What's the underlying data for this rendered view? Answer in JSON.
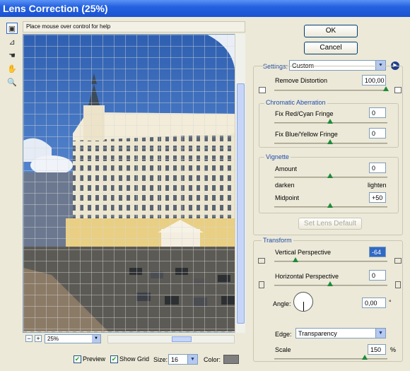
{
  "window": {
    "title": "Lens Correction (25%)"
  },
  "hint": "Place mouse over control for help",
  "buttons": {
    "ok": "OK",
    "cancel": "Cancel",
    "set_lens_default": "Set Lens Default"
  },
  "settings": {
    "label": "Settings:",
    "value": "Custom"
  },
  "remove_distortion": {
    "label": "Remove Distortion",
    "value": "100,00"
  },
  "chromatic": {
    "title": "Chromatic Aberration",
    "red_cyan": {
      "label": "Fix Red/Cyan Fringe",
      "value": "0"
    },
    "blue_yellow": {
      "label": "Fix Blue/Yellow Fringe",
      "value": "0"
    }
  },
  "vignette": {
    "title": "Vignette",
    "amount": {
      "label": "Amount",
      "value": "0"
    },
    "darken": "darken",
    "lighten": "lighten",
    "midpoint": {
      "label": "Midpoint",
      "value": "+50"
    }
  },
  "transform": {
    "title": "Transform",
    "vertical": {
      "label": "Vertical Perspective",
      "value": "-64"
    },
    "horizontal": {
      "label": "Horizontal Perspective",
      "value": "0"
    },
    "angle": {
      "label": "Angle:",
      "value": "0,00",
      "unit": "°"
    },
    "edge": {
      "label": "Edge:",
      "value": "Transparency"
    },
    "scale": {
      "label": "Scale",
      "value": "150",
      "unit": "%"
    }
  },
  "zoom": {
    "value": "25%",
    "minus": "−",
    "plus": "+"
  },
  "options": {
    "preview": "Preview",
    "show_grid": "Show Grid",
    "size_label": "Size:",
    "size_value": "16",
    "color_label": "Color:",
    "grid_color": "#7f7f7f"
  }
}
